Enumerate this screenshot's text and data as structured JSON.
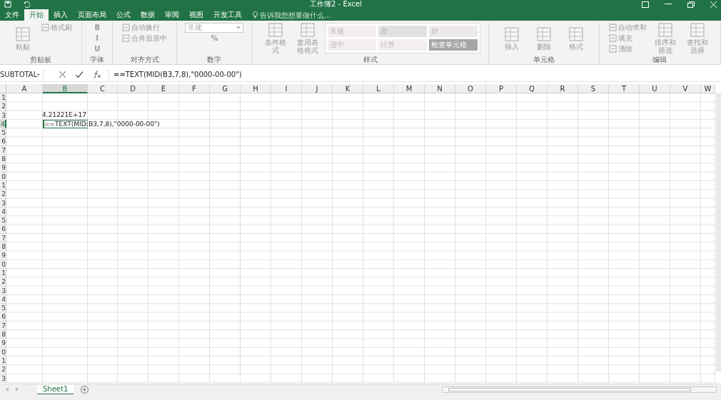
{
  "window": {
    "title": "工作簿2 - Excel"
  },
  "tabs": [
    {
      "label": "文件",
      "selected": false
    },
    {
      "label": "开始",
      "selected": true
    },
    {
      "label": "插入",
      "selected": false
    },
    {
      "label": "页面布局",
      "selected": false
    },
    {
      "label": "公式",
      "selected": false
    },
    {
      "label": "数据",
      "selected": false
    },
    {
      "label": "审阅",
      "selected": false
    },
    {
      "label": "视图",
      "selected": false
    },
    {
      "label": "开发工具",
      "selected": false
    }
  ],
  "tell_me": {
    "placeholder": "告诉我您想要做什么..."
  },
  "ribbon": [
    {
      "label": "剪贴板",
      "items": [
        {
          "kind": "large",
          "label": "粘贴"
        },
        {
          "kind": "small",
          "label": "格式刷"
        }
      ]
    },
    {
      "label": "字体",
      "items": [
        {
          "kind": "text_button",
          "label": "B"
        },
        {
          "kind": "text_button",
          "label": "I"
        },
        {
          "kind": "text_button",
          "label": "U"
        }
      ]
    },
    {
      "label": "对齐方式",
      "items": [
        {
          "kind": "small",
          "label": "自动换行"
        },
        {
          "kind": "small",
          "label": "合并后居中"
        }
      ]
    },
    {
      "label": "数字",
      "items": [
        {
          "kind": "dropdown",
          "label": "常规"
        },
        {
          "kind": "text_button",
          "label": "%"
        }
      ]
    },
    {
      "label": "样式",
      "items": [
        {
          "kind": "large",
          "label": "条件格式"
        },
        {
          "kind": "large",
          "label": "套用表格格式"
        },
        {
          "kind": "gallery",
          "cells": [
            {
              "label": "常规",
              "color": "#f5eef1"
            },
            {
              "label": "差",
              "color": "#e2e0e1"
            },
            {
              "label": "好",
              "color": "#eeeaec"
            },
            {
              "label": "适中",
              "color": "#f5eef1"
            },
            {
              "label": "计算",
              "color": "#f5eef1"
            },
            {
              "label": "检查单元格",
              "color": "#a6a6a6"
            }
          ]
        }
      ]
    },
    {
      "label": "单元格",
      "items": [
        {
          "kind": "large",
          "label": "插入"
        },
        {
          "kind": "large",
          "label": "删除"
        },
        {
          "kind": "large",
          "label": "格式"
        }
      ]
    },
    {
      "label": "编辑",
      "items": [
        {
          "kind": "small",
          "label": "自动求和"
        },
        {
          "kind": "small",
          "label": "填充"
        },
        {
          "kind": "small",
          "label": "清除"
        },
        {
          "kind": "large",
          "label": "排序和筛选"
        },
        {
          "kind": "large",
          "label": "查找和选择"
        }
      ]
    }
  ],
  "name_box": {
    "value": "SUBTOTAL"
  },
  "formula_bar": {
    "value": "==TEXT(MID(B3,7,8),\"0000-00-00\")"
  },
  "columns": [
    {
      "label": "A",
      "selected": false
    },
    {
      "label": "B",
      "selected": true
    },
    {
      "label": "C",
      "selected": false
    },
    {
      "label": "D",
      "selected": false
    },
    {
      "label": "E",
      "selected": false
    },
    {
      "label": "F",
      "selected": false
    },
    {
      "label": "G",
      "selected": false
    },
    {
      "label": "H",
      "selected": false
    },
    {
      "label": "I",
      "selected": false
    },
    {
      "label": "J",
      "selected": false
    },
    {
      "label": "K",
      "selected": false
    },
    {
      "label": "L",
      "selected": false
    },
    {
      "label": "M",
      "selected": false
    },
    {
      "label": "N",
      "selected": false
    },
    {
      "label": "O",
      "selected": false
    },
    {
      "label": "P",
      "selected": false
    },
    {
      "label": "Q",
      "selected": false
    },
    {
      "label": "R",
      "selected": false
    },
    {
      "label": "S",
      "selected": false
    },
    {
      "label": "T",
      "selected": false
    },
    {
      "label": "U",
      "selected": false
    },
    {
      "label": "V",
      "selected": false
    },
    {
      "label": "W",
      "selected": false
    }
  ],
  "rows": [
    {
      "label": "1",
      "selected": false
    },
    {
      "label": "2",
      "selected": false
    },
    {
      "label": "3",
      "selected": false,
      "cells": [
        null,
        {
          "text": "4.21221E+17",
          "active": false
        }
      ]
    },
    {
      "label": "4",
      "selected": true,
      "cells": [
        null,
        {
          "text": "==TEXT(MID(B3,7,8),\"0000-00-00\")",
          "active": true
        }
      ]
    },
    {
      "label": "5",
      "selected": false
    },
    {
      "label": "6",
      "selected": false
    },
    {
      "label": "7",
      "selected": false
    },
    {
      "label": "8",
      "selected": false
    },
    {
      "label": "9",
      "selected": false
    },
    {
      "label": "0",
      "selected": false
    },
    {
      "label": "1",
      "selected": false
    },
    {
      "label": "2",
      "selected": false
    },
    {
      "label": "3",
      "selected": false
    },
    {
      "label": "4",
      "selected": false
    },
    {
      "label": "5",
      "selected": false
    },
    {
      "label": "6",
      "selected": false
    },
    {
      "label": "7",
      "selected": false
    },
    {
      "label": "8",
      "selected": false
    },
    {
      "label": "9",
      "selected": false
    },
    {
      "label": "0",
      "selected": false
    },
    {
      "label": "1",
      "selected": false
    },
    {
      "label": "2",
      "selected": false
    },
    {
      "label": "3",
      "selected": false
    },
    {
      "label": "4",
      "selected": false
    },
    {
      "label": "5",
      "selected": false
    },
    {
      "label": "6",
      "selected": false
    },
    {
      "label": "7",
      "selected": false
    },
    {
      "label": "8",
      "selected": false
    },
    {
      "label": "9",
      "selected": false
    },
    {
      "label": "0",
      "selected": false
    },
    {
      "label": "1",
      "selected": false
    },
    {
      "label": "2",
      "selected": false
    },
    {
      "label": "3",
      "selected": false
    }
  ],
  "sheets": [
    {
      "label": "Sheet1",
      "selected": true
    }
  ]
}
